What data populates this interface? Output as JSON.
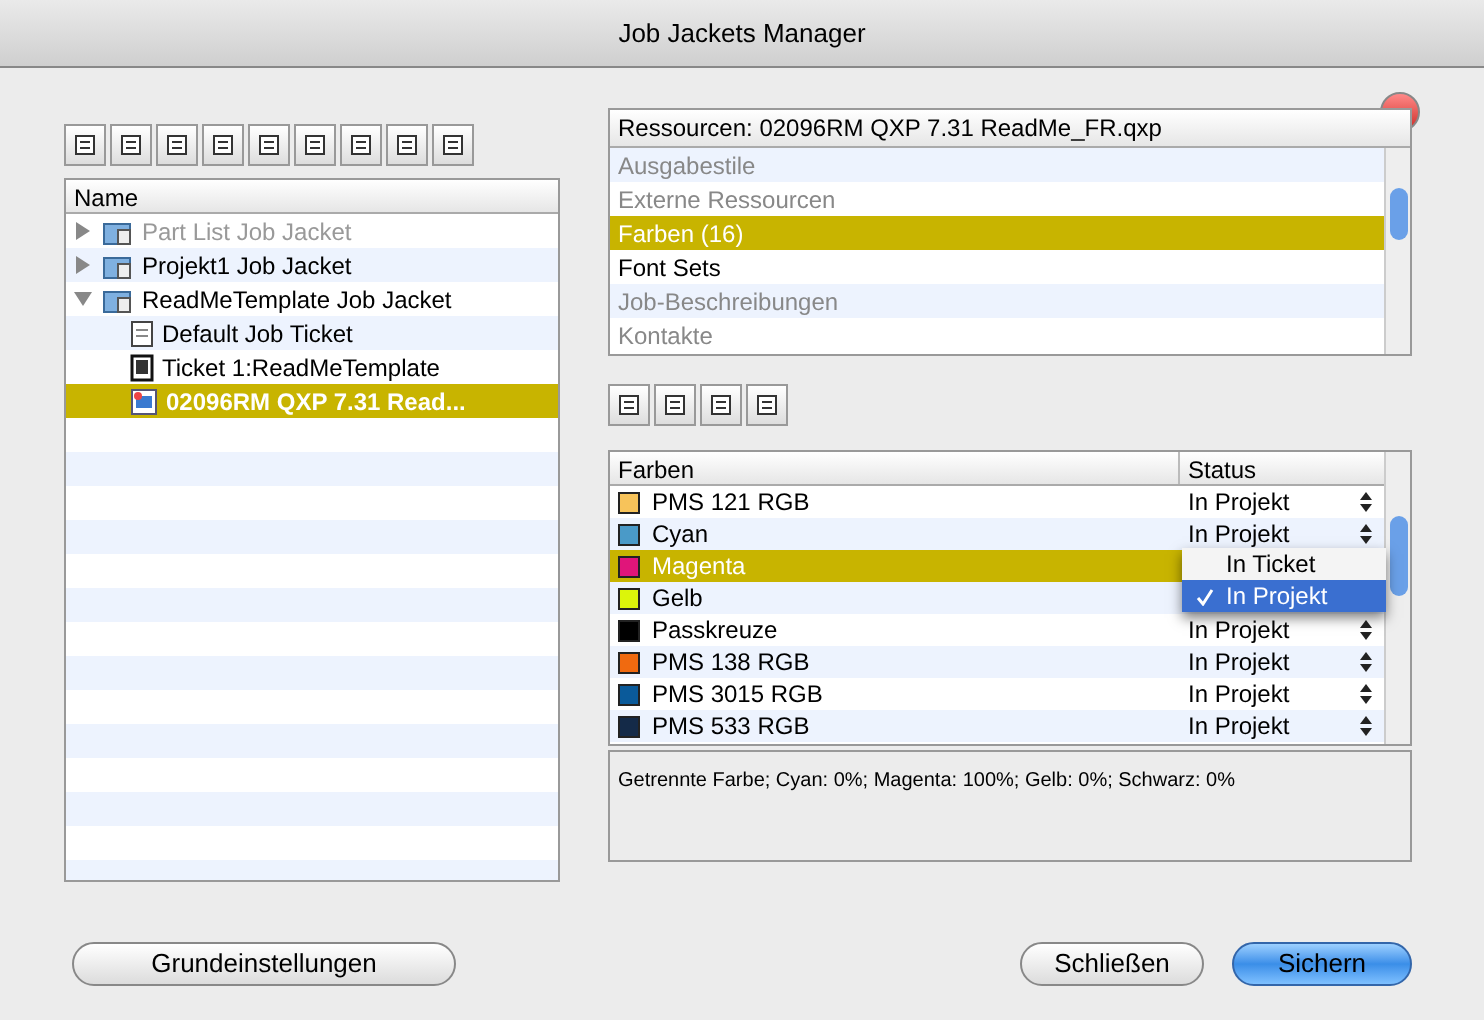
{
  "window": {
    "title": "Job Jackets Manager"
  },
  "tree": {
    "column": "Name",
    "items": [
      {
        "label": "Part List Job Jacket",
        "kind": "jacket",
        "expanded": false,
        "disabled": true,
        "selected": false
      },
      {
        "label": "Projekt1 Job Jacket",
        "kind": "jacket",
        "expanded": false,
        "disabled": false,
        "selected": false
      },
      {
        "label": "ReadMeTemplate Job Jacket",
        "kind": "jacket",
        "expanded": true,
        "disabled": false,
        "selected": false,
        "children": [
          {
            "label": "Default Job Ticket",
            "kind": "ticket",
            "disabled": false,
            "selected": false
          },
          {
            "label": "Ticket 1:ReadMeTemplate",
            "kind": "ticket-linked",
            "disabled": false,
            "selected": false
          },
          {
            "label": "02096RM QXP 7.31 Read...",
            "kind": "project",
            "disabled": false,
            "selected": true
          }
        ]
      }
    ]
  },
  "resources": {
    "header": "Ressourcen: 02096RM QXP 7.31 ReadMe_FR.qxp",
    "items": [
      {
        "label": "Ausgabestile",
        "available": false,
        "selected": false
      },
      {
        "label": "Externe Ressourcen",
        "available": false,
        "selected": false
      },
      {
        "label": "Farben (16)",
        "available": true,
        "selected": true
      },
      {
        "label": "Font Sets",
        "available": true,
        "selected": false
      },
      {
        "label": "Job-Beschreibungen",
        "available": false,
        "selected": false
      },
      {
        "label": "Kontakte",
        "available": false,
        "selected": false
      }
    ]
  },
  "colors": {
    "columns": [
      "Farben",
      "Status"
    ],
    "rows": [
      {
        "name": "PMS 121 RGB",
        "color": "#f7c35a",
        "status": "In Projekt",
        "selected": false
      },
      {
        "name": "Cyan",
        "color": "#4a9ac8",
        "status": "In Projekt",
        "selected": false
      },
      {
        "name": "Magenta",
        "color": "#e0157a",
        "selected": true
      },
      {
        "name": "Gelb",
        "color": "#dcf50a",
        "selected": false
      },
      {
        "name": "Passkreuze",
        "color": "#000000",
        "status": "In Projekt",
        "selected": false
      },
      {
        "name": "PMS 138 RGB",
        "color": "#f06a10",
        "status": "In Projekt",
        "selected": false
      },
      {
        "name": "PMS 3015 RGB",
        "color": "#0a5a9a",
        "status": "In Projekt",
        "selected": false
      },
      {
        "name": "PMS 533 RGB",
        "color": "#142a48",
        "status": "In Projekt",
        "selected": false
      }
    ]
  },
  "status_menu": [
    {
      "label": "In Ticket",
      "selected": false
    },
    {
      "label": "In Projekt",
      "selected": true
    }
  ],
  "description": "Getrennte Farbe; Cyan: 0%; Magenta: 100%; Gelb: 0%; Schwarz: 0%",
  "buttons": [
    {
      "label": "Grundeinstellungen",
      "kind": "plain"
    },
    {
      "label": "Schließen",
      "kind": "plain"
    },
    {
      "label": "Sichern",
      "kind": "default"
    }
  ]
}
